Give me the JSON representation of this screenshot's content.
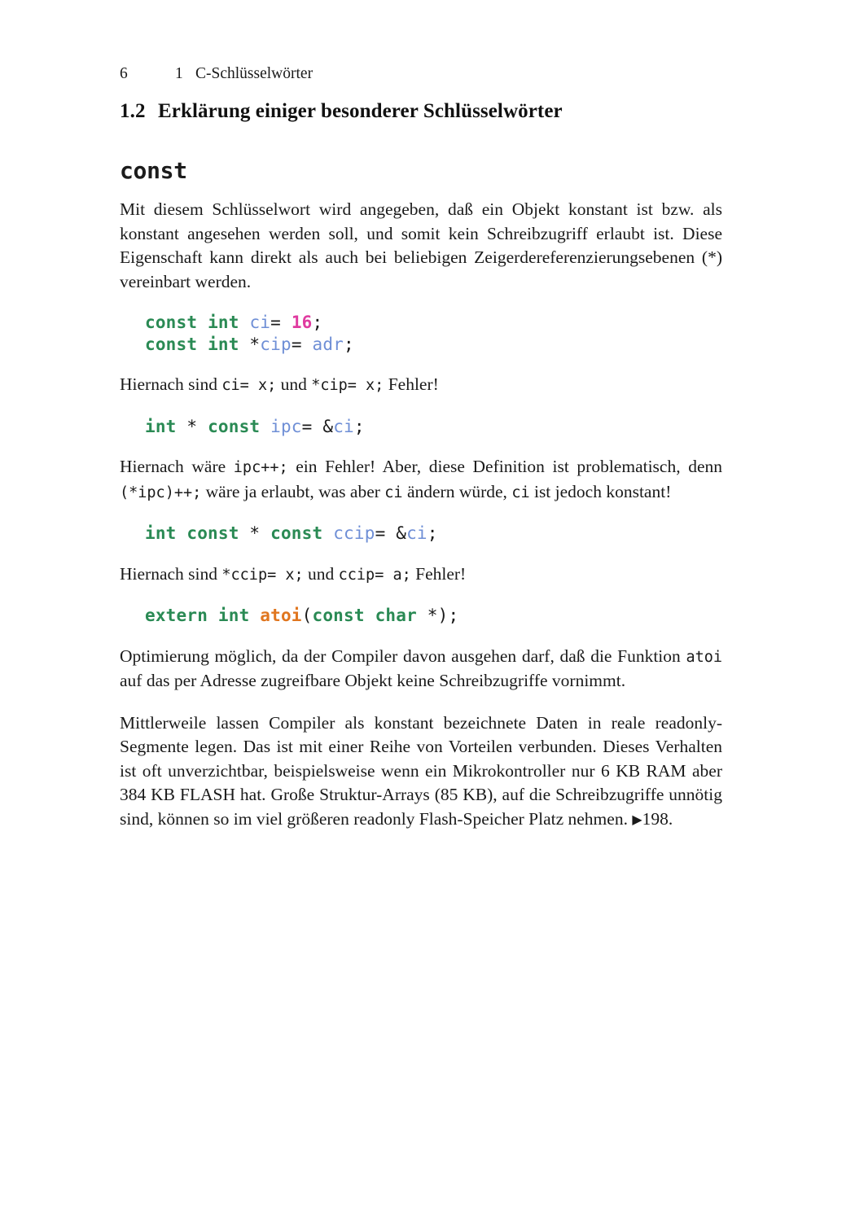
{
  "page": {
    "folio": "6",
    "running_head": {
      "chapter_number": "1",
      "chapter_title": "C-Schlüsselwörter"
    }
  },
  "section": {
    "number": "1.2",
    "title": "Erklärung einiger besonderer Schlüsselwörter"
  },
  "keyword_entry": {
    "heading": "const",
    "intro_paragraph": "Mit diesem Schlüsselwort wird angegeben, daß ein Objekt konstant ist bzw. als konstant angesehen werden soll, und somit kein Schreibzugriff erlaubt ist. Diese Eigenschaft kann direkt als auch bei beliebigen Zeigerdereferenzierungsebenen (*) vereinbart werden."
  },
  "code_block_1": {
    "lines": [
      {
        "tokens": [
          {
            "text": "const",
            "type": "keyword"
          },
          {
            "text": " ",
            "type": "plain"
          },
          {
            "text": "int",
            "type": "keyword"
          },
          {
            "text": " ",
            "type": "plain"
          },
          {
            "text": "ci",
            "type": "identifier"
          },
          {
            "text": "= ",
            "type": "punctuation"
          },
          {
            "text": "16",
            "type": "number"
          },
          {
            "text": ";",
            "type": "punctuation"
          }
        ]
      },
      {
        "tokens": [
          {
            "text": "const",
            "type": "keyword"
          },
          {
            "text": " ",
            "type": "plain"
          },
          {
            "text": "int",
            "type": "keyword"
          },
          {
            "text": " *",
            "type": "punctuation"
          },
          {
            "text": "cip",
            "type": "identifier"
          },
          {
            "text": "= ",
            "type": "punctuation"
          },
          {
            "text": "adr",
            "type": "identifier"
          },
          {
            "text": ";",
            "type": "punctuation"
          }
        ]
      }
    ]
  },
  "note_1": {
    "part_1": "Hiernach sind ",
    "code_1": "ci= x;",
    "part_2": " und ",
    "code_2": "*cip= x;",
    "part_3": " Fehler!"
  },
  "code_block_2": {
    "lines": [
      {
        "tokens": [
          {
            "text": "int",
            "type": "keyword"
          },
          {
            "text": " * ",
            "type": "punctuation"
          },
          {
            "text": "const",
            "type": "keyword"
          },
          {
            "text": " ",
            "type": "plain"
          },
          {
            "text": "ipc",
            "type": "identifier"
          },
          {
            "text": "= &",
            "type": "punctuation"
          },
          {
            "text": "ci",
            "type": "identifier"
          },
          {
            "text": ";",
            "type": "punctuation"
          }
        ]
      }
    ]
  },
  "note_2": {
    "part_1": "Hiernach wäre ",
    "code_1": "ipc++;",
    "part_2": " ein Fehler! Aber, diese Definition ist problematisch, denn ",
    "code_2": "(*ipc)++;",
    "part_3": " wäre ja erlaubt, was aber ",
    "code_3": "ci",
    "part_4": " ändern würde, ",
    "code_4": "ci",
    "part_5": " ist jedoch konstant!"
  },
  "code_block_3": {
    "lines": [
      {
        "tokens": [
          {
            "text": "int",
            "type": "keyword"
          },
          {
            "text": " ",
            "type": "plain"
          },
          {
            "text": "const",
            "type": "keyword"
          },
          {
            "text": " * ",
            "type": "punctuation"
          },
          {
            "text": "const",
            "type": "keyword"
          },
          {
            "text": " ",
            "type": "plain"
          },
          {
            "text": "ccip",
            "type": "identifier"
          },
          {
            "text": "= &",
            "type": "punctuation"
          },
          {
            "text": "ci",
            "type": "identifier"
          },
          {
            "text": ";",
            "type": "punctuation"
          }
        ]
      }
    ]
  },
  "note_3": {
    "part_1": "Hiernach sind ",
    "code_1": "*ccip= x;",
    "part_2": " und ",
    "code_2": "ccip= a;",
    "part_3": " Fehler!"
  },
  "code_block_4": {
    "lines": [
      {
        "tokens": [
          {
            "text": "extern",
            "type": "keyword"
          },
          {
            "text": " ",
            "type": "plain"
          },
          {
            "text": "int",
            "type": "keyword"
          },
          {
            "text": " ",
            "type": "plain"
          },
          {
            "text": "atoi",
            "type": "function"
          },
          {
            "text": "(",
            "type": "punctuation"
          },
          {
            "text": "const",
            "type": "keyword"
          },
          {
            "text": " ",
            "type": "plain"
          },
          {
            "text": "char",
            "type": "keyword"
          },
          {
            "text": " *);",
            "type": "punctuation"
          }
        ]
      }
    ]
  },
  "note_4": {
    "part_1": "Optimierung möglich, da der Compiler davon ausgehen darf, daß die Funktion ",
    "code_1": "atoi",
    "part_2": " auf das per Adresse zugreifbare Objekt keine Schreibzugriffe vornimmt."
  },
  "closing_paragraph": {
    "text": "Mittlerweile lassen Compiler als konstant bezeichnete Daten in reale readonly-Segmente legen. Das ist mit einer Reihe von Vorteilen verbunden. Dieses Verhalten ist oft unverzichtbar, beispielsweise wenn ein Mikrokontroller nur 6 KB RAM aber 384 KB FLASH hat. Große Struktur-Arrays (85 KB), auf die Schreibzugriffe unnötig sind, können so im viel größeren readonly Flash-Speicher Platz nehmen. ",
    "cross_reference_marker": "▶",
    "cross_reference_page": "198."
  },
  "colors": {
    "keyword_green": "#2a8a54",
    "identifier_blue": "#6f8fd6",
    "number_magenta": "#e03ba0",
    "function_orange": "#e0761f",
    "text_black": "#1a1a1a",
    "page_background": "#ffffff"
  }
}
